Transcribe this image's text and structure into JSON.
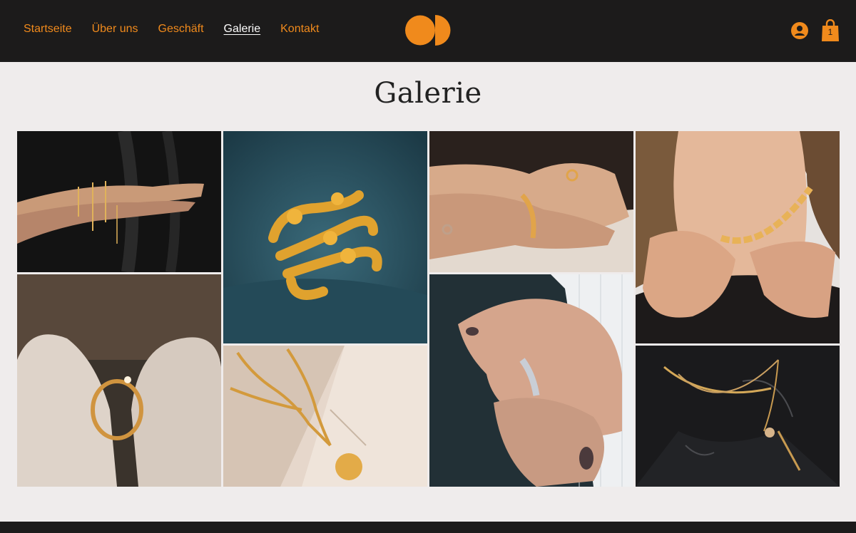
{
  "nav": {
    "items": [
      {
        "label": "Startseite"
      },
      {
        "label": "Über uns"
      },
      {
        "label": "Geschäft"
      },
      {
        "label": "Galerie",
        "active": true
      },
      {
        "label": "Kontakt"
      }
    ]
  },
  "header": {
    "logo_icon": "brand-logo-circles",
    "user_icon": "user-account-icon",
    "cart_icon": "shopping-bag-icon",
    "cart_count": "1",
    "accent_color": "#f08a1c",
    "bar_color": "#1c1b1b"
  },
  "page": {
    "title": "Galerie"
  },
  "gallery": {
    "images": [
      {
        "name": "bracelets-hands-black-dress"
      },
      {
        "name": "gold-wavy-ring-teal-fabric"
      },
      {
        "name": "hands-ring-bangle-table"
      },
      {
        "name": "woman-holding-chain-necklace"
      },
      {
        "name": "ring-between-shoes"
      },
      {
        "name": "chain-necklace-pendant-marble"
      },
      {
        "name": "hands-stacked-silver-ring"
      },
      {
        "name": "layered-necklaces-black-marble"
      }
    ]
  }
}
